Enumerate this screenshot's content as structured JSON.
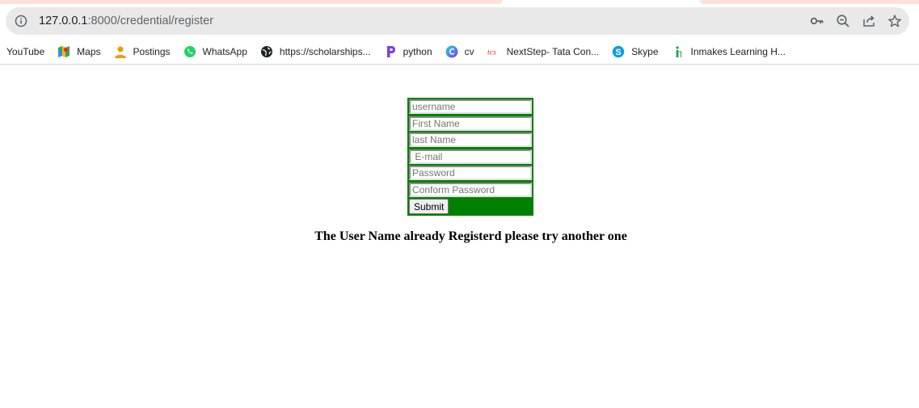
{
  "browser": {
    "url_host": "127.0.0.1",
    "url_rest": ":8000/credential/register",
    "icons": [
      "info-icon",
      "key-icon",
      "zoom-out-icon",
      "share-icon",
      "star-icon"
    ]
  },
  "bookmarks": [
    {
      "label": "YouTube",
      "icon": ""
    },
    {
      "label": "Maps",
      "icon": "maps-icon"
    },
    {
      "label": "Postings",
      "icon": "person-icon"
    },
    {
      "label": "WhatsApp",
      "icon": "whatsapp-icon"
    },
    {
      "label": "https://scholarships...",
      "icon": "globe-icon"
    },
    {
      "label": "python",
      "icon": "python-p-icon"
    },
    {
      "label": "cv",
      "icon": "canva-icon"
    },
    {
      "label": "NextStep- Tata Con...",
      "icon": "tcs-icon"
    },
    {
      "label": "Skype",
      "icon": "skype-icon"
    },
    {
      "label": "Inmakes Learning H...",
      "icon": "inmakes-icon"
    }
  ],
  "form": {
    "background": "#008000",
    "username_placeholder": "username",
    "first_name_placeholder": "First Name",
    "last_name_placeholder": "last Name",
    "email_placeholder": " E-mail",
    "password_placeholder": "Password",
    "confirm_password_placeholder": "Conform Password",
    "submit_label": "Submit"
  },
  "message": "The User Name already Registerd please try another one"
}
